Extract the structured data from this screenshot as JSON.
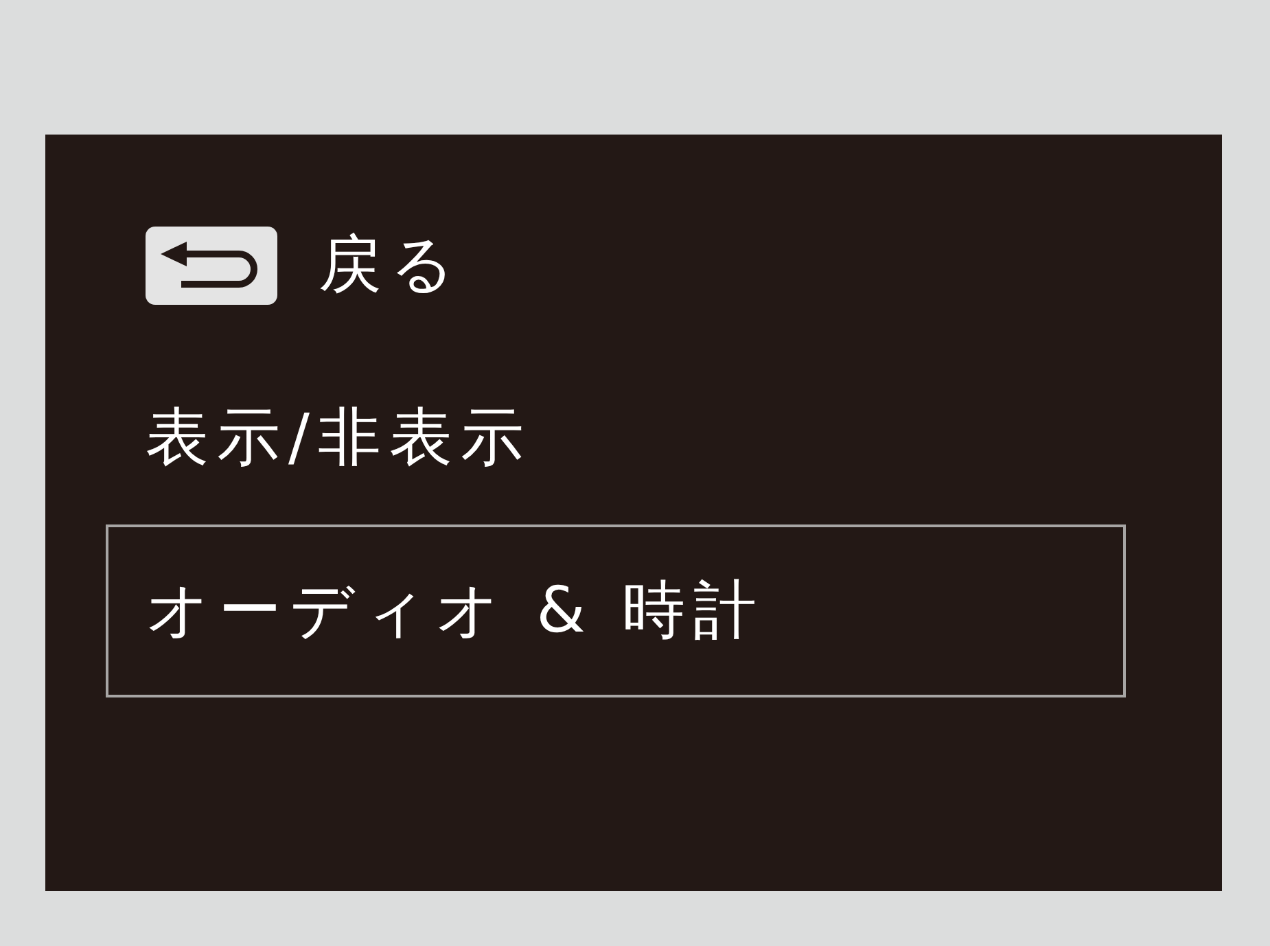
{
  "menu": [
    {
      "kind": "back",
      "label": "戻る",
      "selected": false
    },
    {
      "kind": "item",
      "label": "表示/非表示",
      "selected": false
    },
    {
      "kind": "item",
      "label": "オーディオ & 時計",
      "selected": true
    }
  ]
}
